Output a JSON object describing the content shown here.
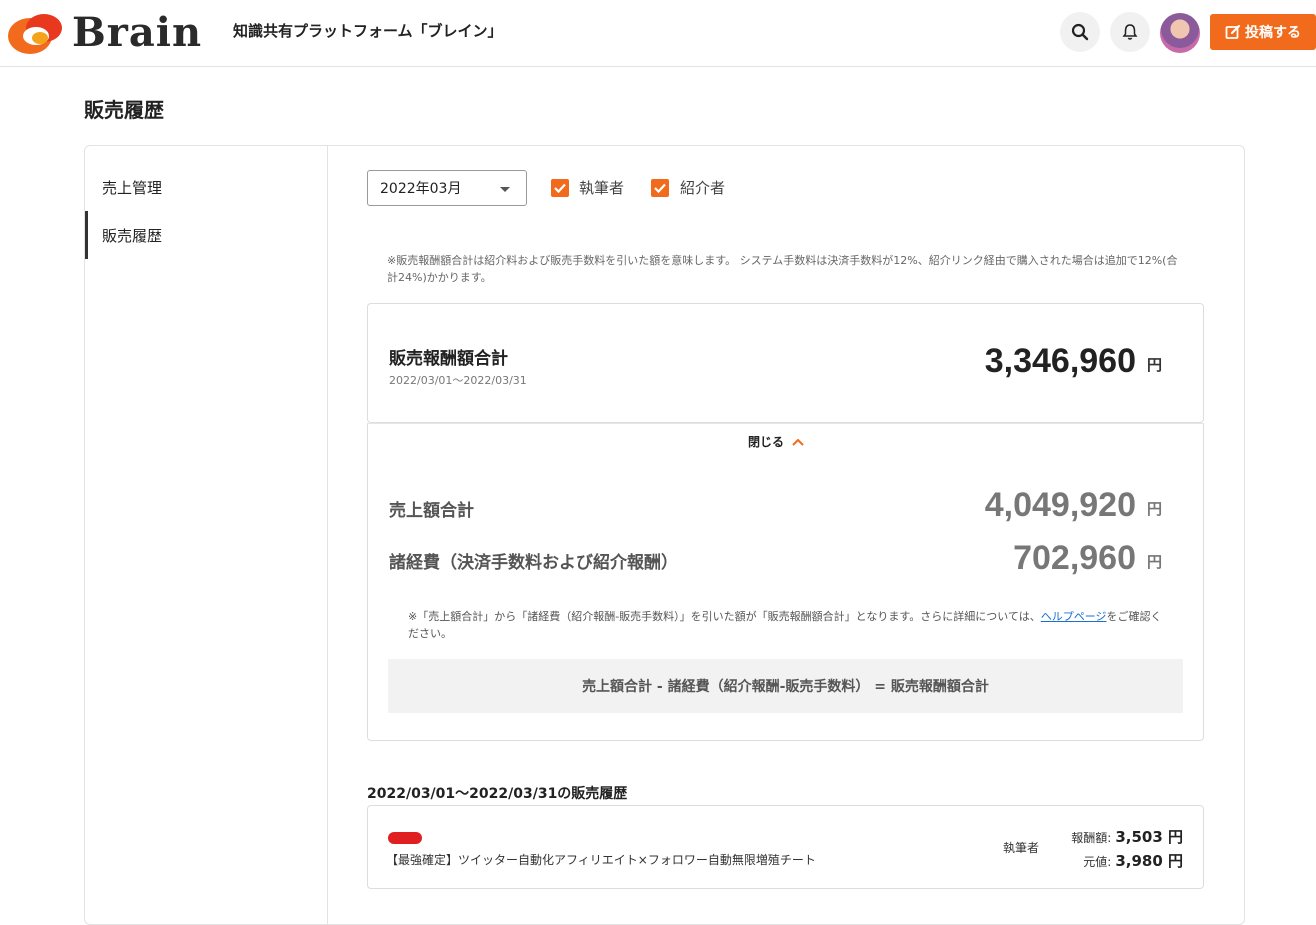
{
  "header": {
    "logo_text": "Brain",
    "tagline": "知識共有プラットフォーム「ブレイン」",
    "post_button": "投稿する"
  },
  "page_title": "販売履歴",
  "sidebar": {
    "items": [
      {
        "label": "売上管理"
      },
      {
        "label": "販売履歴"
      }
    ]
  },
  "filters": {
    "month": "2022年03月",
    "checkbox_author": "執筆者",
    "checkbox_referrer": "紹介者"
  },
  "notes": {
    "fee_note": "※販売報酬額合計は紹介料および販売手数料を引いた額を意味します。 システム手数料は決済手数料が12%、紹介リンク経由で購入された場合は追加で12%(合計24%)かかります。"
  },
  "summary": {
    "title": "販売報酬額合計",
    "range": "2022/03/01〜2022/03/31",
    "amount": "3,346,960",
    "yen": "円"
  },
  "detail": {
    "close_label": "閉じる",
    "sales_label": "売上額合計",
    "sales_amount": "4,049,920",
    "expenses_label": "諸経費（決済手数料および紹介報酬）",
    "expenses_amount": "702,960",
    "yen": "円",
    "note_prefix": "※「売上額合計」から「諸経費（紹介報酬-販売手数料）」を引いた額が「販売報酬額合計」となります。さらに詳細については、",
    "note_link": "ヘルプページ",
    "note_suffix": "をご確認ください。",
    "formula": "売上額合計 - 諸経費（紹介報酬-販売手数料） = 販売報酬額合計"
  },
  "history": {
    "title": "2022/03/01〜2022/03/31の販売履歴",
    "items": [
      {
        "title": "【最強確定】ツイッター自動化アフィリエイト×フォロワー自動無限増殖チート",
        "role": "執筆者",
        "reward_label": "報酬額:",
        "reward": "3,503 円",
        "price_label": "元値:",
        "price": "3,980 円"
      }
    ]
  },
  "colors": {
    "accent": "#f26a1b"
  }
}
